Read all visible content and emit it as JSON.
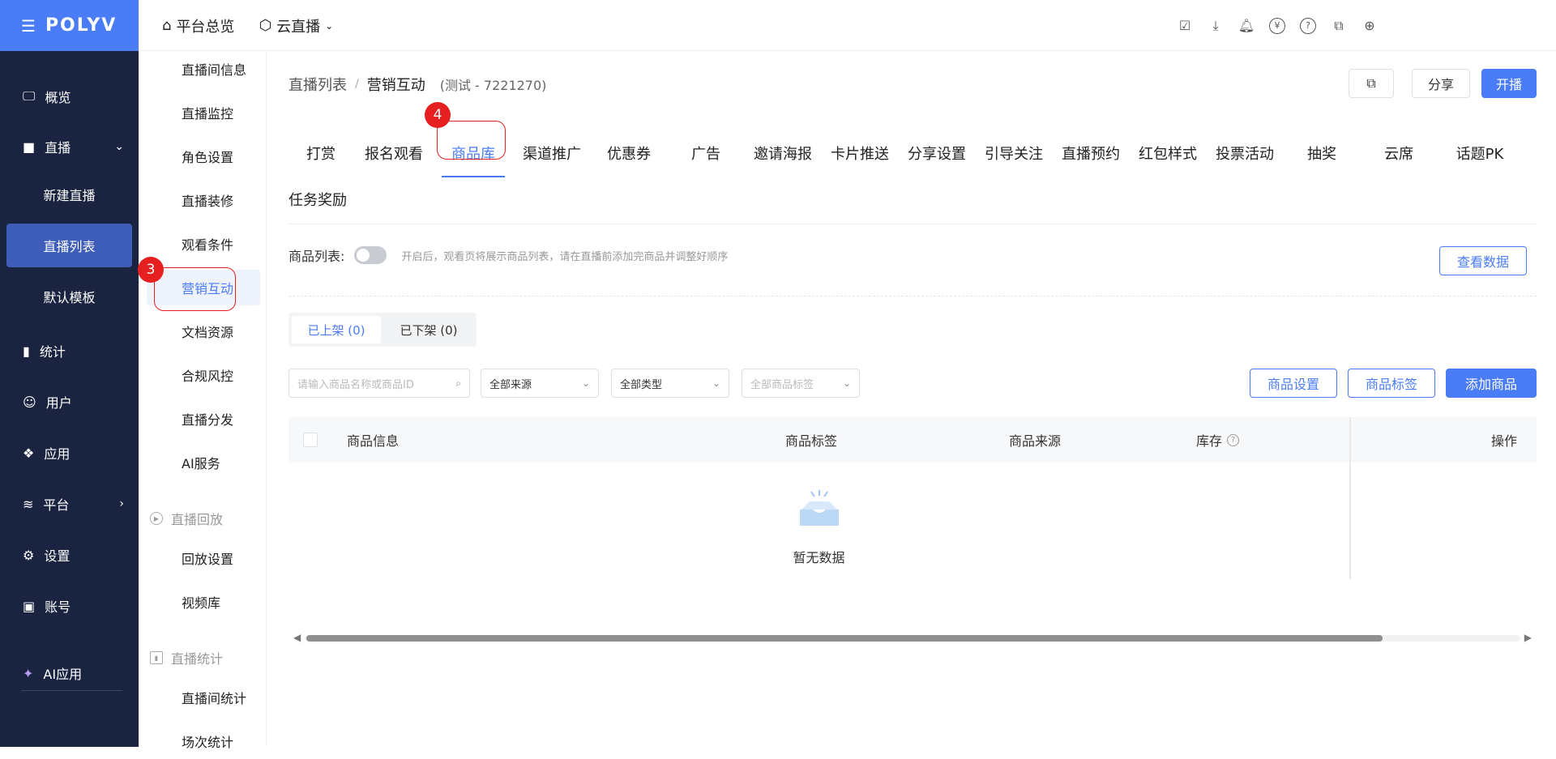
{
  "topbar": {
    "brand": "POLYV",
    "nav": [
      {
        "label": "平台总览",
        "icon": "home-icon"
      },
      {
        "label": "云直播",
        "icon": "cube-icon"
      }
    ],
    "icons": [
      "task-icon",
      "download-icon",
      "bell-icon",
      "yuan-icon",
      "help-icon",
      "code-icon",
      "globe-icon"
    ]
  },
  "sidebar": {
    "items": [
      {
        "label": "概览",
        "icon": "monitor-icon"
      },
      {
        "label": "直播",
        "icon": "camera-icon"
      },
      {
        "label": "统计",
        "icon": "chart-icon"
      },
      {
        "label": "用户",
        "icon": "user-icon"
      },
      {
        "label": "应用",
        "icon": "apps-icon"
      },
      {
        "label": "平台",
        "icon": "layers-icon"
      },
      {
        "label": "设置",
        "icon": "gear-icon"
      },
      {
        "label": "账号",
        "icon": "id-card-icon"
      },
      {
        "label": "AI应用",
        "icon": "sparkle-icon"
      }
    ],
    "live_sub": [
      "新建直播",
      "直播列表",
      "默认模板"
    ]
  },
  "sidebar2": {
    "items": [
      "直播间信息",
      "直播监控",
      "角色设置",
      "直播装修",
      "观看条件",
      "营销互动",
      "文档资源",
      "合规风控",
      "直播分发",
      "AI服务"
    ],
    "group_playback": "直播回放",
    "playback_items": [
      "回放设置",
      "视频库"
    ],
    "group_stats": "直播统计",
    "stats_items": [
      "直播间统计",
      "场次统计"
    ]
  },
  "annotations": {
    "step3": "3",
    "step4": "4"
  },
  "header": {
    "crumb_root": "直播列表",
    "crumb_sep": "/",
    "crumb_current": "营销互动",
    "crumb_sub": "(测试 - 7221270)",
    "share": "分享",
    "start": "开播"
  },
  "tabs": [
    "打赏",
    "报名观看",
    "商品库",
    "渠道推广",
    "优惠券",
    "广告",
    "邀请海报",
    "卡片推送",
    "分享设置",
    "引导关注",
    "直播预约",
    "红包样式",
    "投票活动",
    "抽奖",
    "云席",
    "话题PK"
  ],
  "tab_row2": "任务奖励",
  "product": {
    "switch_label": "商品列表:",
    "switch_hint": "开启后，观看页将展示商品列表，请在直播前添加完商品并调整好顺序",
    "view_data": "查看数据",
    "seg_on": "已上架 (0)",
    "seg_off": "已下架 (0)",
    "search_placeholder": "请输入商品名称或商品ID",
    "source_select": "全部来源",
    "type_select": "全部类型",
    "tag_select": "全部商品标签",
    "btn_settings": "商品设置",
    "btn_tags": "商品标签",
    "btn_add": "添加商品",
    "columns": [
      "商品信息",
      "商品标签",
      "商品来源",
      "库存",
      "操作"
    ],
    "empty": "暂无数据"
  }
}
